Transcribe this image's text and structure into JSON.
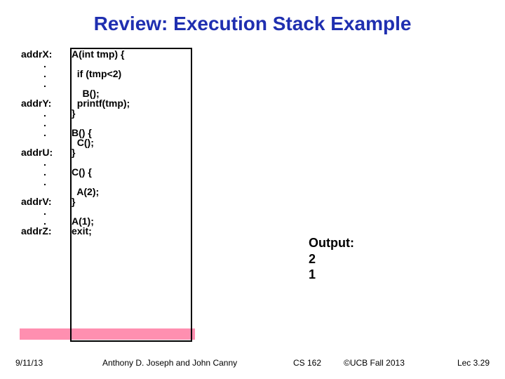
{
  "title": "Review: Execution Stack Example",
  "code_rows": [
    {
      "addr": "addrX:",
      "code": "A(int tmp) {"
    },
    {
      "addr": ".",
      "code": ""
    },
    {
      "addr": ".",
      "code": "  if (tmp<2)"
    },
    {
      "addr": ".",
      "code": ""
    },
    {
      "addr": "",
      "code": "    B();"
    },
    {
      "addr": "",
      "code": ""
    },
    {
      "addr": "addrY:",
      "code": "  printf(tmp);"
    },
    {
      "addr": "",
      "code": ""
    },
    {
      "addr": ".",
      "code": "}"
    },
    {
      "addr": ".",
      "code": ""
    },
    {
      "addr": ".",
      "code": "B() {"
    },
    {
      "addr": "",
      "code": ""
    },
    {
      "addr": "",
      "code": "  C();"
    },
    {
      "addr": "",
      "code": ""
    },
    {
      "addr": "addrU:",
      "code": "}"
    },
    {
      "addr": ".",
      "code": ""
    },
    {
      "addr": ".",
      "code": "C() {"
    },
    {
      "addr": ".",
      "code": ""
    },
    {
      "addr": "",
      "code": "  A(2);"
    },
    {
      "addr": "",
      "code": ""
    },
    {
      "addr": "addrV:",
      "code": "}"
    },
    {
      "addr": ".",
      "code": ""
    },
    {
      "addr": ".",
      "code": "A(1);"
    },
    {
      "addr": "",
      "code": ""
    },
    {
      "addr": "addrZ:",
      "code": "exit;"
    }
  ],
  "output": {
    "label": "Output:",
    "lines": [
      "2",
      "1"
    ]
  },
  "footer": {
    "date": "9/11/13",
    "author": "Anthony D. Joseph and John Canny",
    "course": "CS 162",
    "copy": "©UCB Fall 2013",
    "lec": "Lec 3.29"
  }
}
